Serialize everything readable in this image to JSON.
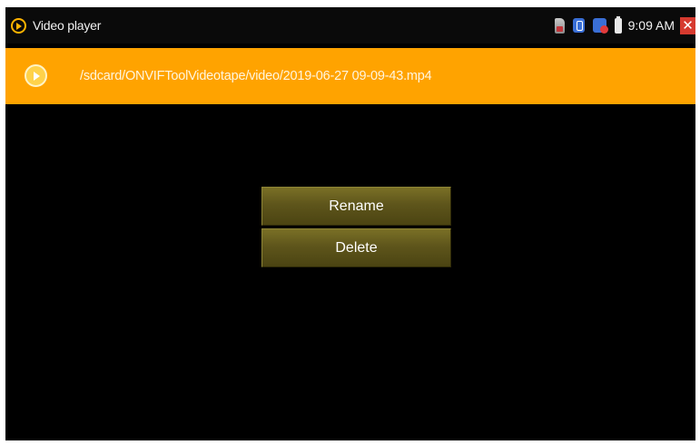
{
  "titlebar": {
    "app_title": "Video player",
    "time": "9:09 AM",
    "close_glyph": "✕",
    "icons": [
      "video-player-icon",
      "sd-card-icon",
      "usb-icon",
      "network-icon",
      "battery-icon",
      "close-icon"
    ]
  },
  "pathbar": {
    "path": "/sdcard/ONVIFToolVideotape/video/2019-06-27 09-09-43.mp4",
    "icon": "play-circle-icon"
  },
  "menu": {
    "items": [
      {
        "label": "Rename"
      },
      {
        "label": "Delete"
      }
    ]
  },
  "colors": {
    "accent": "#ffa300",
    "background": "#000000",
    "menu_button": "#5e551b",
    "close": "#d63a2f"
  }
}
